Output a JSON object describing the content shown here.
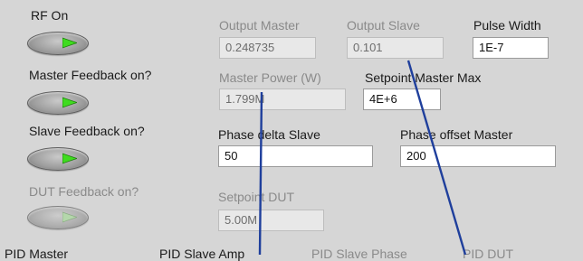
{
  "colors": {
    "panel_background": "#d6d6d6",
    "led_on": "#3fdc1f",
    "annotation_line": "#1f3f9c"
  },
  "left_panel": {
    "rf_on": {
      "label": "RF On",
      "state": "on",
      "icon": "green-led-icon"
    },
    "master_feedback": {
      "label": "Master Feedback on?",
      "state": "on",
      "icon": "green-led-icon"
    },
    "slave_feedback": {
      "label": "Slave Feedback on?",
      "state": "on",
      "icon": "green-led-icon"
    },
    "dut_feedback": {
      "label": "DUT Feedback on?",
      "state": "on",
      "enabled": false,
      "icon": "green-led-icon"
    }
  },
  "fields": {
    "output_master": {
      "label": "Output Master",
      "value": "0.248735"
    },
    "output_slave": {
      "label": "Output Slave",
      "value": "0.101"
    },
    "pulse_width": {
      "label": "Pulse Width",
      "value": "1E-7"
    },
    "master_power": {
      "label": "Master Power (W)",
      "value": "1.799M"
    },
    "setpoint_master_max": {
      "label": "Setpoint Master Max",
      "value": "4E+6"
    },
    "phase_delta_slave": {
      "label": "Phase delta Slave",
      "value": "50"
    },
    "phase_offset_master": {
      "label": "Phase offset Master",
      "value": "200"
    },
    "setpoint_dut": {
      "label": "Setpoint DUT",
      "value": "5.00M"
    }
  },
  "bottom_tabs": [
    "PID Master",
    "PID Slave Amp",
    "PID Slave Phase",
    "PID DUT"
  ]
}
